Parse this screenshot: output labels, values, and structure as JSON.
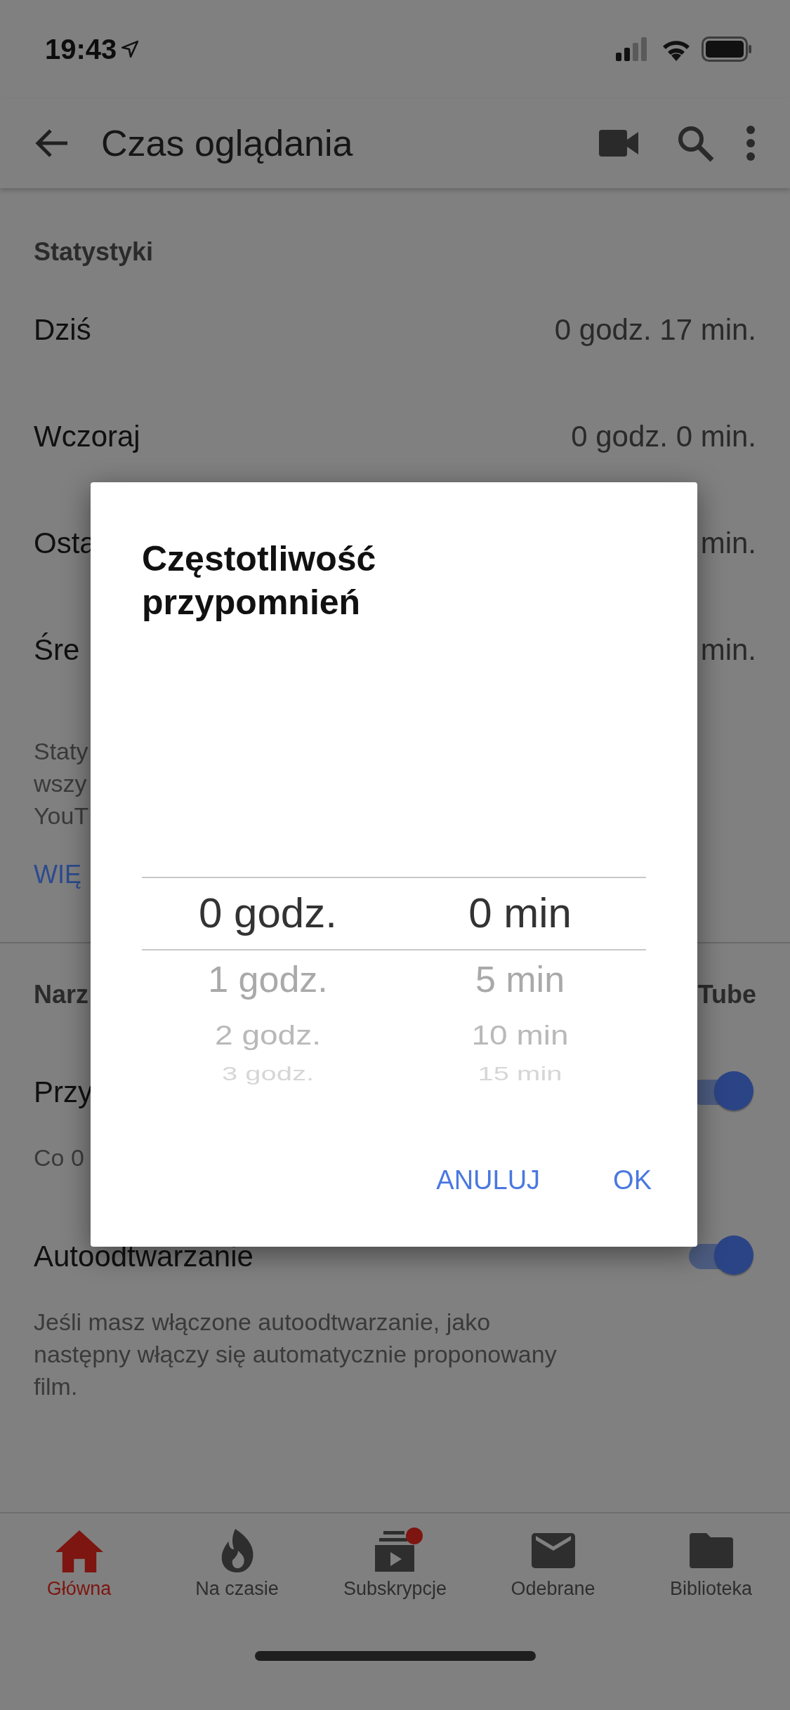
{
  "status_bar": {
    "time": "19:43"
  },
  "app_bar": {
    "title": "Czas oglądania"
  },
  "stats": {
    "heading": "Statystyki",
    "rows": [
      {
        "label": "Dziś",
        "value": "0 godz. 17 min."
      },
      {
        "label": "Wczoraj",
        "value": "0 godz. 0 min."
      },
      {
        "label": "Osta",
        "value": "min."
      },
      {
        "label": "Śre",
        "value": "min."
      }
    ],
    "description": [
      "Staty",
      "wszy",
      "YouT"
    ],
    "link": "WIĘ"
  },
  "tools": {
    "heading": "Narz",
    "heading_end": "Tube",
    "settings": [
      {
        "label": "Przy",
        "description": [
          "Co 0"
        ],
        "on": true
      },
      {
        "label": "Autoodtwarzanie",
        "description": [
          "Jeśli masz włączone autoodtwarzanie, jako",
          "następny włączy się automatycznie proponowany",
          "film."
        ],
        "on": true
      }
    ]
  },
  "dialog": {
    "title": "Częstotliwość przypomnień",
    "picker": {
      "columns": [
        {
          "items": [
            {
              "label": "0 godz.",
              "selected": true
            },
            {
              "label": "1 godz.",
              "selected": false
            },
            {
              "label": "2 godz.",
              "selected": false
            },
            {
              "label": "3 godz.",
              "selected": false
            }
          ]
        },
        {
          "items": [
            {
              "label": "0 min",
              "selected": true
            },
            {
              "label": "5 min",
              "selected": false
            },
            {
              "label": "10 min",
              "selected": false
            },
            {
              "label": "15 min",
              "selected": false
            }
          ]
        }
      ]
    },
    "buttons": [
      "ANULUJ",
      "OK"
    ]
  },
  "bottom_nav": [
    {
      "label": "Główna",
      "kind": "home",
      "selected": true,
      "badge": false
    },
    {
      "label": "Na czasie",
      "kind": "trending",
      "selected": false,
      "badge": false
    },
    {
      "label": "Subskrypcje",
      "kind": "subscriptions",
      "selected": false,
      "badge": true
    },
    {
      "label": "Odebrane",
      "kind": "inbox",
      "selected": false,
      "badge": false
    },
    {
      "label": "Biblioteka",
      "kind": "library",
      "selected": false,
      "badge": false
    }
  ]
}
